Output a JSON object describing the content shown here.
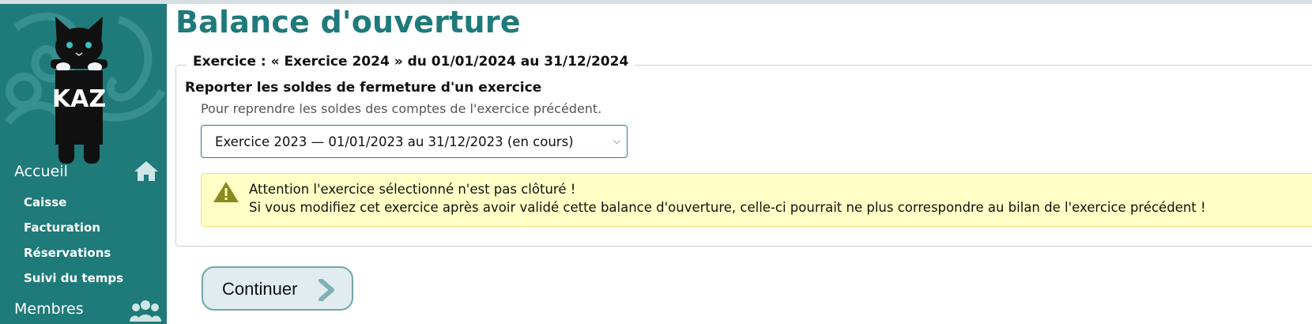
{
  "sidebar": {
    "logo_text": "KAZ",
    "sections": [
      {
        "label": "Accueil",
        "icon": "home-icon"
      },
      {
        "label": "Membres",
        "icon": "users-icon"
      }
    ],
    "items": [
      {
        "label": "Caisse"
      },
      {
        "label": "Facturation"
      },
      {
        "label": "Réservations"
      },
      {
        "label": "Suivi du temps"
      }
    ],
    "colors": {
      "background": "#1f7a7a",
      "text": "#ffffff"
    }
  },
  "page": {
    "title": "Balance d'ouverture",
    "legend": "Exercice : « Exercice 2024 » du 01/01/2024 au 31/12/2024",
    "section_title": "Reporter les soldes de fermeture d'un exercice",
    "help": "Pour reprendre les soldes des comptes de l'exercice précédent.",
    "select_value": "Exercice 2023 — 01/01/2023 au 31/12/2023 (en cours)",
    "alert": {
      "icon": "warning-icon",
      "line1": "Attention l'exercice sélectionné n'est pas clôturé !",
      "line2": "Si vous modifiez cet exercice après avoir validé cette balance d'ouverture, celle-ci pourrait ne plus correspondre au bilan de l'exercice précédent !"
    },
    "continue_label": "Continuer"
  },
  "colors": {
    "accent": "#1f7a7a",
    "alert_bg": "#ffffc6",
    "warning": "#8a8a1e"
  }
}
